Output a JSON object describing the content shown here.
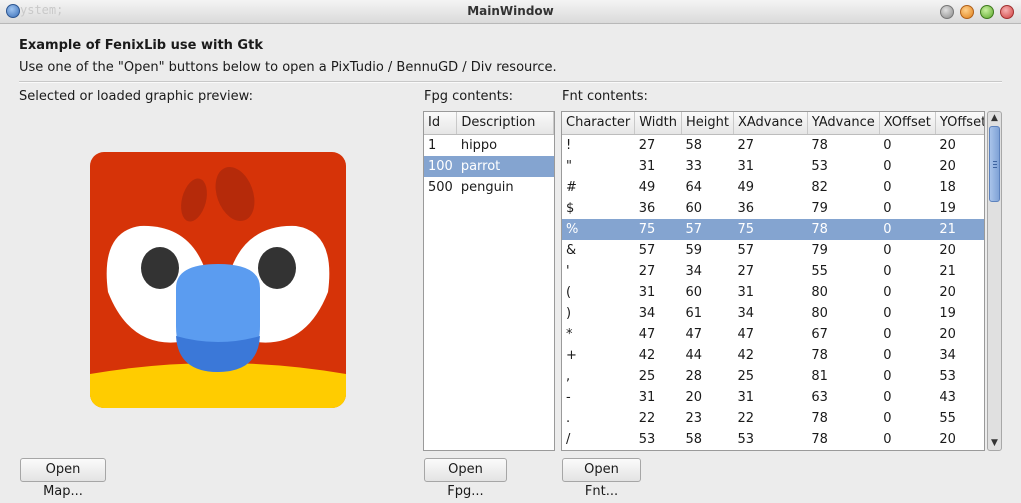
{
  "window": {
    "title": "MainWindow",
    "ghost_text": "ystem;"
  },
  "header": {
    "title": "Example of FenixLib use with Gtk",
    "subtitle": "Use one of the \"Open\" buttons below to open a PixTudio / BennuGD / Div resource."
  },
  "preview": {
    "label": "Selected or loaded graphic preview:",
    "open_button": "Open Map..."
  },
  "fpg": {
    "label": "Fpg contents:",
    "columns": [
      "Id",
      "Description"
    ],
    "rows": [
      [
        "1",
        "hippo"
      ],
      [
        "100",
        "parrot"
      ],
      [
        "500",
        "penguin"
      ]
    ],
    "selected_index": 1,
    "open_button": "Open Fpg..."
  },
  "fnt": {
    "label": "Fnt contents:",
    "columns": [
      "Character",
      "Width",
      "Height",
      "XAdvance",
      "YAdvance",
      "XOffset",
      "YOffset"
    ],
    "rows": [
      [
        "!",
        "27",
        "58",
        "27",
        "78",
        "0",
        "20"
      ],
      [
        "\"",
        "31",
        "33",
        "31",
        "53",
        "0",
        "20"
      ],
      [
        "#",
        "49",
        "64",
        "49",
        "82",
        "0",
        "18"
      ],
      [
        "$",
        "36",
        "60",
        "36",
        "79",
        "0",
        "19"
      ],
      [
        "%",
        "75",
        "57",
        "75",
        "78",
        "0",
        "21"
      ],
      [
        "&",
        "57",
        "59",
        "57",
        "79",
        "0",
        "20"
      ],
      [
        "'",
        "27",
        "34",
        "27",
        "55",
        "0",
        "21"
      ],
      [
        "(",
        "31",
        "60",
        "31",
        "80",
        "0",
        "20"
      ],
      [
        ")",
        "34",
        "61",
        "34",
        "80",
        "0",
        "19"
      ],
      [
        "*",
        "47",
        "47",
        "47",
        "67",
        "0",
        "20"
      ],
      [
        "+",
        "42",
        "44",
        "42",
        "78",
        "0",
        "34"
      ],
      [
        ",",
        "25",
        "28",
        "25",
        "81",
        "0",
        "53"
      ],
      [
        "-",
        "31",
        "20",
        "31",
        "63",
        "0",
        "43"
      ],
      [
        ".",
        "22",
        "23",
        "22",
        "78",
        "0",
        "55"
      ],
      [
        "/",
        "53",
        "58",
        "53",
        "78",
        "0",
        "20"
      ]
    ],
    "selected_index": 4,
    "open_button": "Open Fnt..."
  },
  "colors": {
    "selection": "#84a4d0",
    "parrot_red": "#d63308",
    "parrot_yellow": "#ffcc00",
    "beak_blue": "#5b9cf0"
  }
}
